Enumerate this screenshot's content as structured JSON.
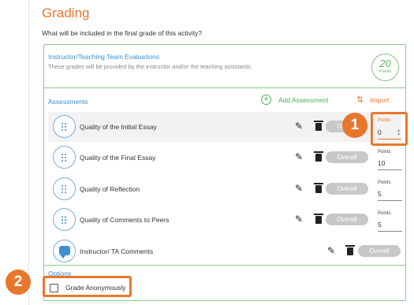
{
  "page": {
    "title": "Grading",
    "question": "What will be included in the final grade of this activity?"
  },
  "evaluations": {
    "title": "Instructor/Teaching Team Evaluations",
    "subtitle": "These grades will be provided by the instructor and/or the teaching assistants.",
    "total_points": "20",
    "total_points_label": "Points"
  },
  "assessments": {
    "label": "Assessments",
    "add_label": "Add Assessment",
    "import_label": "Import",
    "overall_label": "Overall",
    "points_label": "Points",
    "items": [
      {
        "name": "Quality of the Initial Essay",
        "points": "0",
        "icon": "dots-grid-icon"
      },
      {
        "name": "Quality of the Final Essay",
        "points": "10",
        "icon": "dots-grid-icon"
      },
      {
        "name": "Quality of Reflection",
        "points": "5",
        "icon": "dots-grid-icon"
      },
      {
        "name": "Quality of Comments to Peers",
        "points": "5",
        "icon": "dots-grid-icon"
      },
      {
        "name": "Instructor/ TA Comments",
        "icon": "comment-icon"
      }
    ]
  },
  "options": {
    "label": "Options",
    "grade_anonymously": "Grade Anonymously",
    "grade_anonymously_checked": false
  },
  "callouts": [
    "1",
    "2"
  ],
  "colors": {
    "accent_orange": "#e8772e",
    "link_blue": "#3d8fd1",
    "green": "#4caf50"
  }
}
